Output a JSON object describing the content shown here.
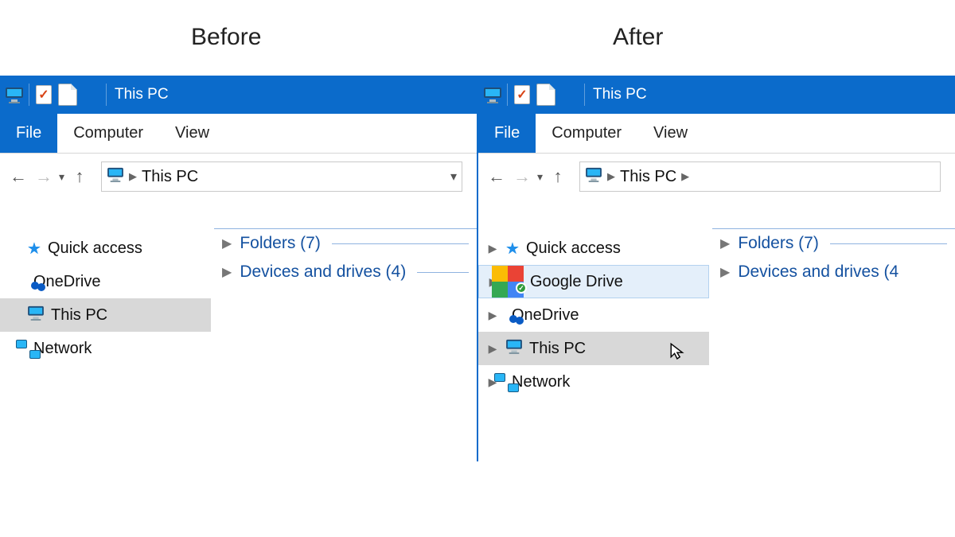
{
  "labels": {
    "before": "Before",
    "after": "After"
  },
  "titlebar": {
    "title": "This PC"
  },
  "ribbon": {
    "file": "File",
    "computer": "Computer",
    "view": "View"
  },
  "addressbar": {
    "thispc": "This PC"
  },
  "sidebar": {
    "quick_access": "Quick access",
    "google_drive": "Google Drive",
    "onedrive": "OneDrive",
    "this_pc": "This PC",
    "network": "Network"
  },
  "content": {
    "folders": "Folders (7)",
    "devices": "Devices and drives (4)",
    "devices_trunc": "Devices and drives (4"
  }
}
